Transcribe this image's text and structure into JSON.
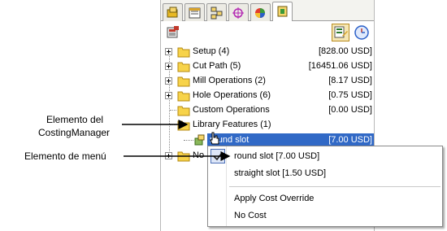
{
  "annotations": {
    "costing_item_line1": "Elemento del",
    "costing_item_line2": "CostingManager",
    "menu_item": "Elemento de menú"
  },
  "tabs": [
    {
      "name": "feature-manager"
    },
    {
      "name": "property-manager"
    },
    {
      "name": "configuration-manager"
    },
    {
      "name": "dimxpert-manager"
    },
    {
      "name": "display-manager"
    },
    {
      "name": "costing-manager"
    }
  ],
  "tree": [
    {
      "label": "Setup (4)",
      "value": "[828.00 USD]",
      "expandable": true
    },
    {
      "label": "Cut Path  (5)",
      "value": "[16451.06 USD]",
      "expandable": true
    },
    {
      "label": "Mill Operations (2)",
      "value": "[8.17 USD]",
      "expandable": true
    },
    {
      "label": "Hole Operations (6)",
      "value": "[0.75 USD]",
      "expandable": true
    },
    {
      "label": "Custom Operations",
      "value": "[0.00 USD]",
      "expandable": false
    },
    {
      "label": "Library Features (1)",
      "value": "",
      "expandable": false
    }
  ],
  "selected_item": {
    "label": "round slot",
    "value": "[7.00 USD]"
  },
  "last_row_label": "No",
  "menu": {
    "items": [
      {
        "label": "round slot [7.00 USD]"
      },
      {
        "label": "straight slot [1.50 USD]"
      },
      {
        "label": "Apply Cost Override"
      },
      {
        "label": "No Cost"
      }
    ]
  },
  "colors": {
    "selection": "#3169c6",
    "folder": "#f7d34a",
    "tab_active": "#ffffff"
  }
}
